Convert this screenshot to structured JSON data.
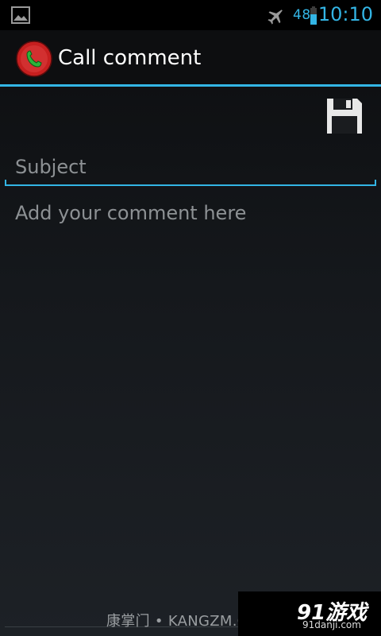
{
  "status_bar": {
    "battery_percent": "48",
    "time": "10:10",
    "icons": [
      "gallery-icon",
      "airplane-mode-icon",
      "battery-icon"
    ]
  },
  "action_bar": {
    "title": "Call comment",
    "app_icon": "call-recorder-icon",
    "save_icon": "floppy-disk-icon"
  },
  "form": {
    "subject_placeholder": "Subject",
    "subject_value": "",
    "comment_placeholder": "Add your comment here",
    "comment_value": ""
  },
  "overlays": {
    "watermark": "康掌门 • KANGZM.COM",
    "logo_main": "91游戏",
    "logo_sub": "91danji.com"
  },
  "colors": {
    "accent": "#33b5e5",
    "placeholder": "#8d9194",
    "icon_red": "#c61f1f",
    "icon_green": "#2bb43a"
  }
}
